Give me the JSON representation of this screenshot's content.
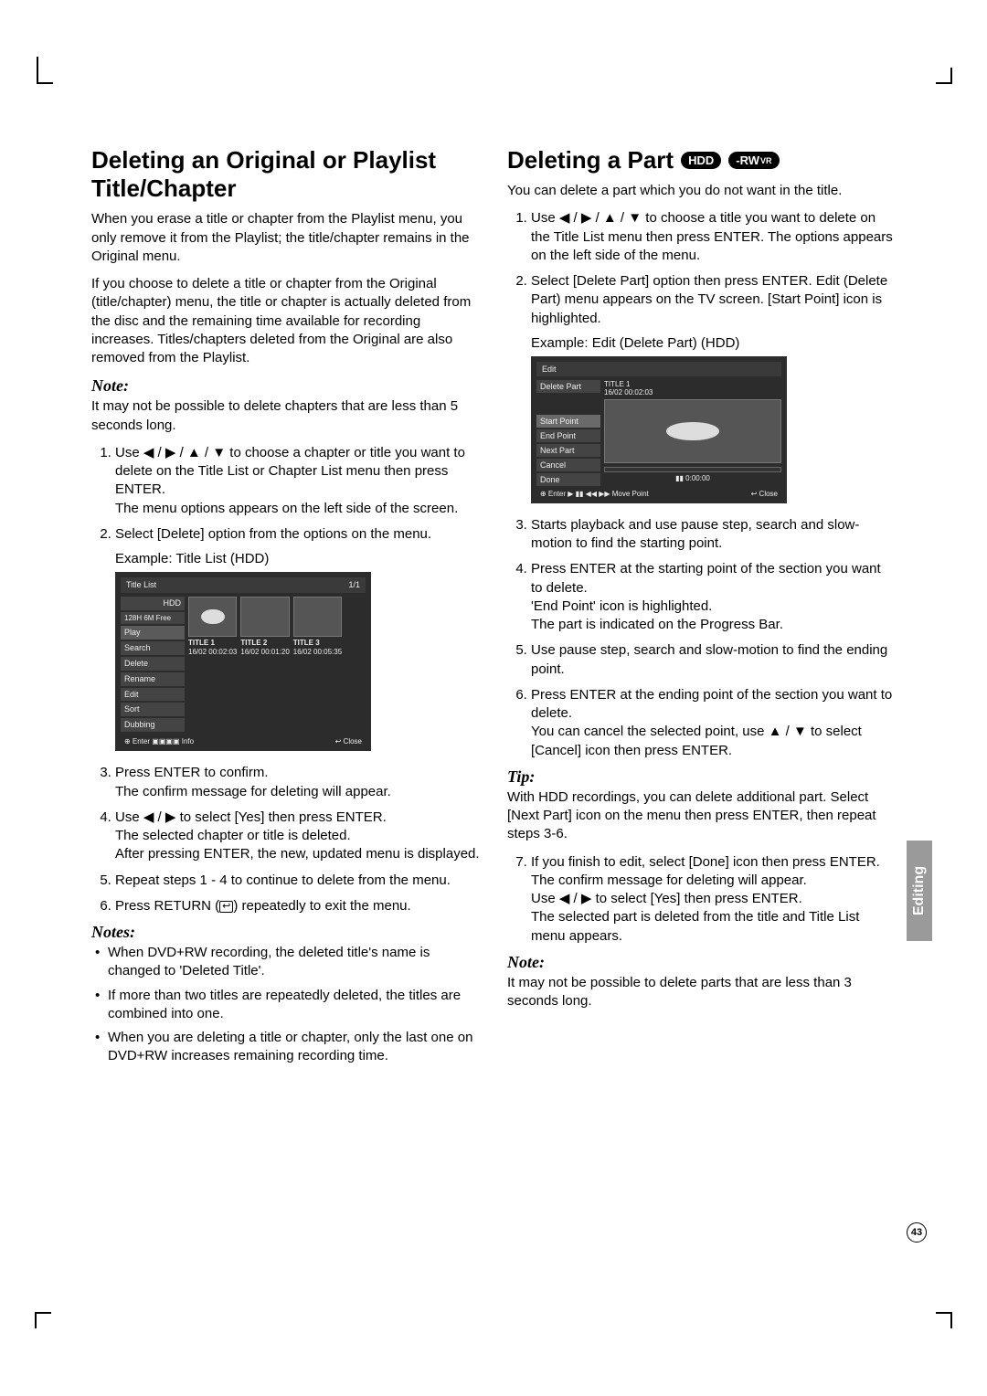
{
  "sidebar_label": "Editing",
  "page_number": "43",
  "left": {
    "h2": "Deleting an Original or Playlist Title/Chapter",
    "p1": "When you erase a title or chapter from the Playlist menu, you only remove it from the Playlist; the title/chapter remains in the Original menu.",
    "p2": "If you choose to delete a title or chapter from the Original (title/chapter) menu, the title or chapter is actually deleted from the disc and the remaining time available for recording increases. Titles/chapters deleted from the Original are also removed from the Playlist.",
    "note1_head": "Note:",
    "note1_body": "It may not be possible to delete chapters that are less than 5 seconds long.",
    "ol1_1": "Use ◀ / ▶ / ▲ / ▼ to choose a chapter or title you want to delete on the Title List or Chapter List menu then press ENTER.\nThe menu options appears on the left side of the screen.",
    "ol1_2": "Select [Delete] option from the options on the menu.",
    "example1": "Example: Title List (HDD)",
    "ss1": {
      "title": "Title List",
      "page": "1/1",
      "hdd": "HDD",
      "free": "128H 6M Free",
      "side": [
        "Play",
        "Search",
        "Delete",
        "Rename",
        "Edit",
        "Sort",
        "Dubbing"
      ],
      "cells": [
        {
          "t": "TITLE 1",
          "d": "16/02  00:02:03"
        },
        {
          "t": "TITLE 2",
          "d": "16/02  00:01:20"
        },
        {
          "t": "TITLE 3",
          "d": "16/02  00:05:35"
        }
      ],
      "foot_l": "⊕ Enter  ▣▣▣▣ Info",
      "foot_r": "↩ Close"
    },
    "ol1_3": "Press ENTER to confirm.\nThe confirm message for deleting will appear.",
    "ol1_4": "Use ◀ / ▶ to select [Yes] then press ENTER.\nThe selected chapter or title is deleted.\nAfter pressing ENTER, the new, updated menu is displayed.",
    "ol1_5": "Repeat steps 1 - 4 to continue to delete from the menu.",
    "ol1_6": "Press RETURN (↩) repeatedly to exit the menu.",
    "notes_head": "Notes:",
    "notes": [
      "When DVD+RW recording, the deleted title's name is changed to 'Deleted Title'.",
      "If more than two titles are repeatedly deleted, the titles are combined into one.",
      "When you are deleting a title or chapter, only the last one on DVD+RW increases remaining recording time."
    ]
  },
  "right": {
    "h2": "Deleting a Part",
    "badges": [
      "HDD",
      "-RW"
    ],
    "badge_sub": "VR",
    "p1": "You can delete a part which you do not want in the title.",
    "ol_1": "Use ◀ / ▶ / ▲ / ▼ to choose a title you want to delete on the Title List menu then press ENTER. The options appears on the left side of the menu.",
    "ol_2": "Select [Delete Part] option then press ENTER. Edit (Delete Part) menu appears on the TV screen. [Start Point] icon is highlighted.",
    "example2": "Example: Edit (Delete Part) (HDD)",
    "ss2": {
      "title": "Edit",
      "left_top": "Delete Part",
      "info": "TITLE 1\n16/02   00:02:03",
      "side": [
        "Start Point",
        "End Point",
        "Next Part",
        "Cancel",
        "Done"
      ],
      "time": "▮▮    0:00:00",
      "foot_l": "⊕ Enter   ▶ ▮▮ ◀◀ ▶▶ Move Point",
      "foot_r": "↩ Close"
    },
    "ol_3": "Starts playback and use pause step, search and slow-motion to find the starting point.",
    "ol_4": "Press ENTER at the starting point of the section you want to delete.\n'End Point' icon is highlighted.\nThe part is indicated on the Progress Bar.",
    "ol_5": "Use pause step, search and slow-motion to find the ending point.",
    "ol_6": "Press ENTER at the ending point of the section you want to delete.\nYou can cancel the selected point, use ▲ / ▼ to select [Cancel] icon then press ENTER.",
    "tip_head": "Tip:",
    "tip_body": "With HDD recordings, you can delete additional part. Select [Next Part] icon on the menu then press ENTER, then repeat steps 3-6.",
    "ol_7": "If you finish to edit, select [Done] icon then press ENTER.\nThe confirm message for deleting will appear.\nUse ◀ / ▶ to select [Yes] then press ENTER.\nThe selected part is deleted from the title and Title List menu appears.",
    "note_head": "Note:",
    "note_body": "It may not be possible to delete parts that are less than 3 seconds long."
  }
}
